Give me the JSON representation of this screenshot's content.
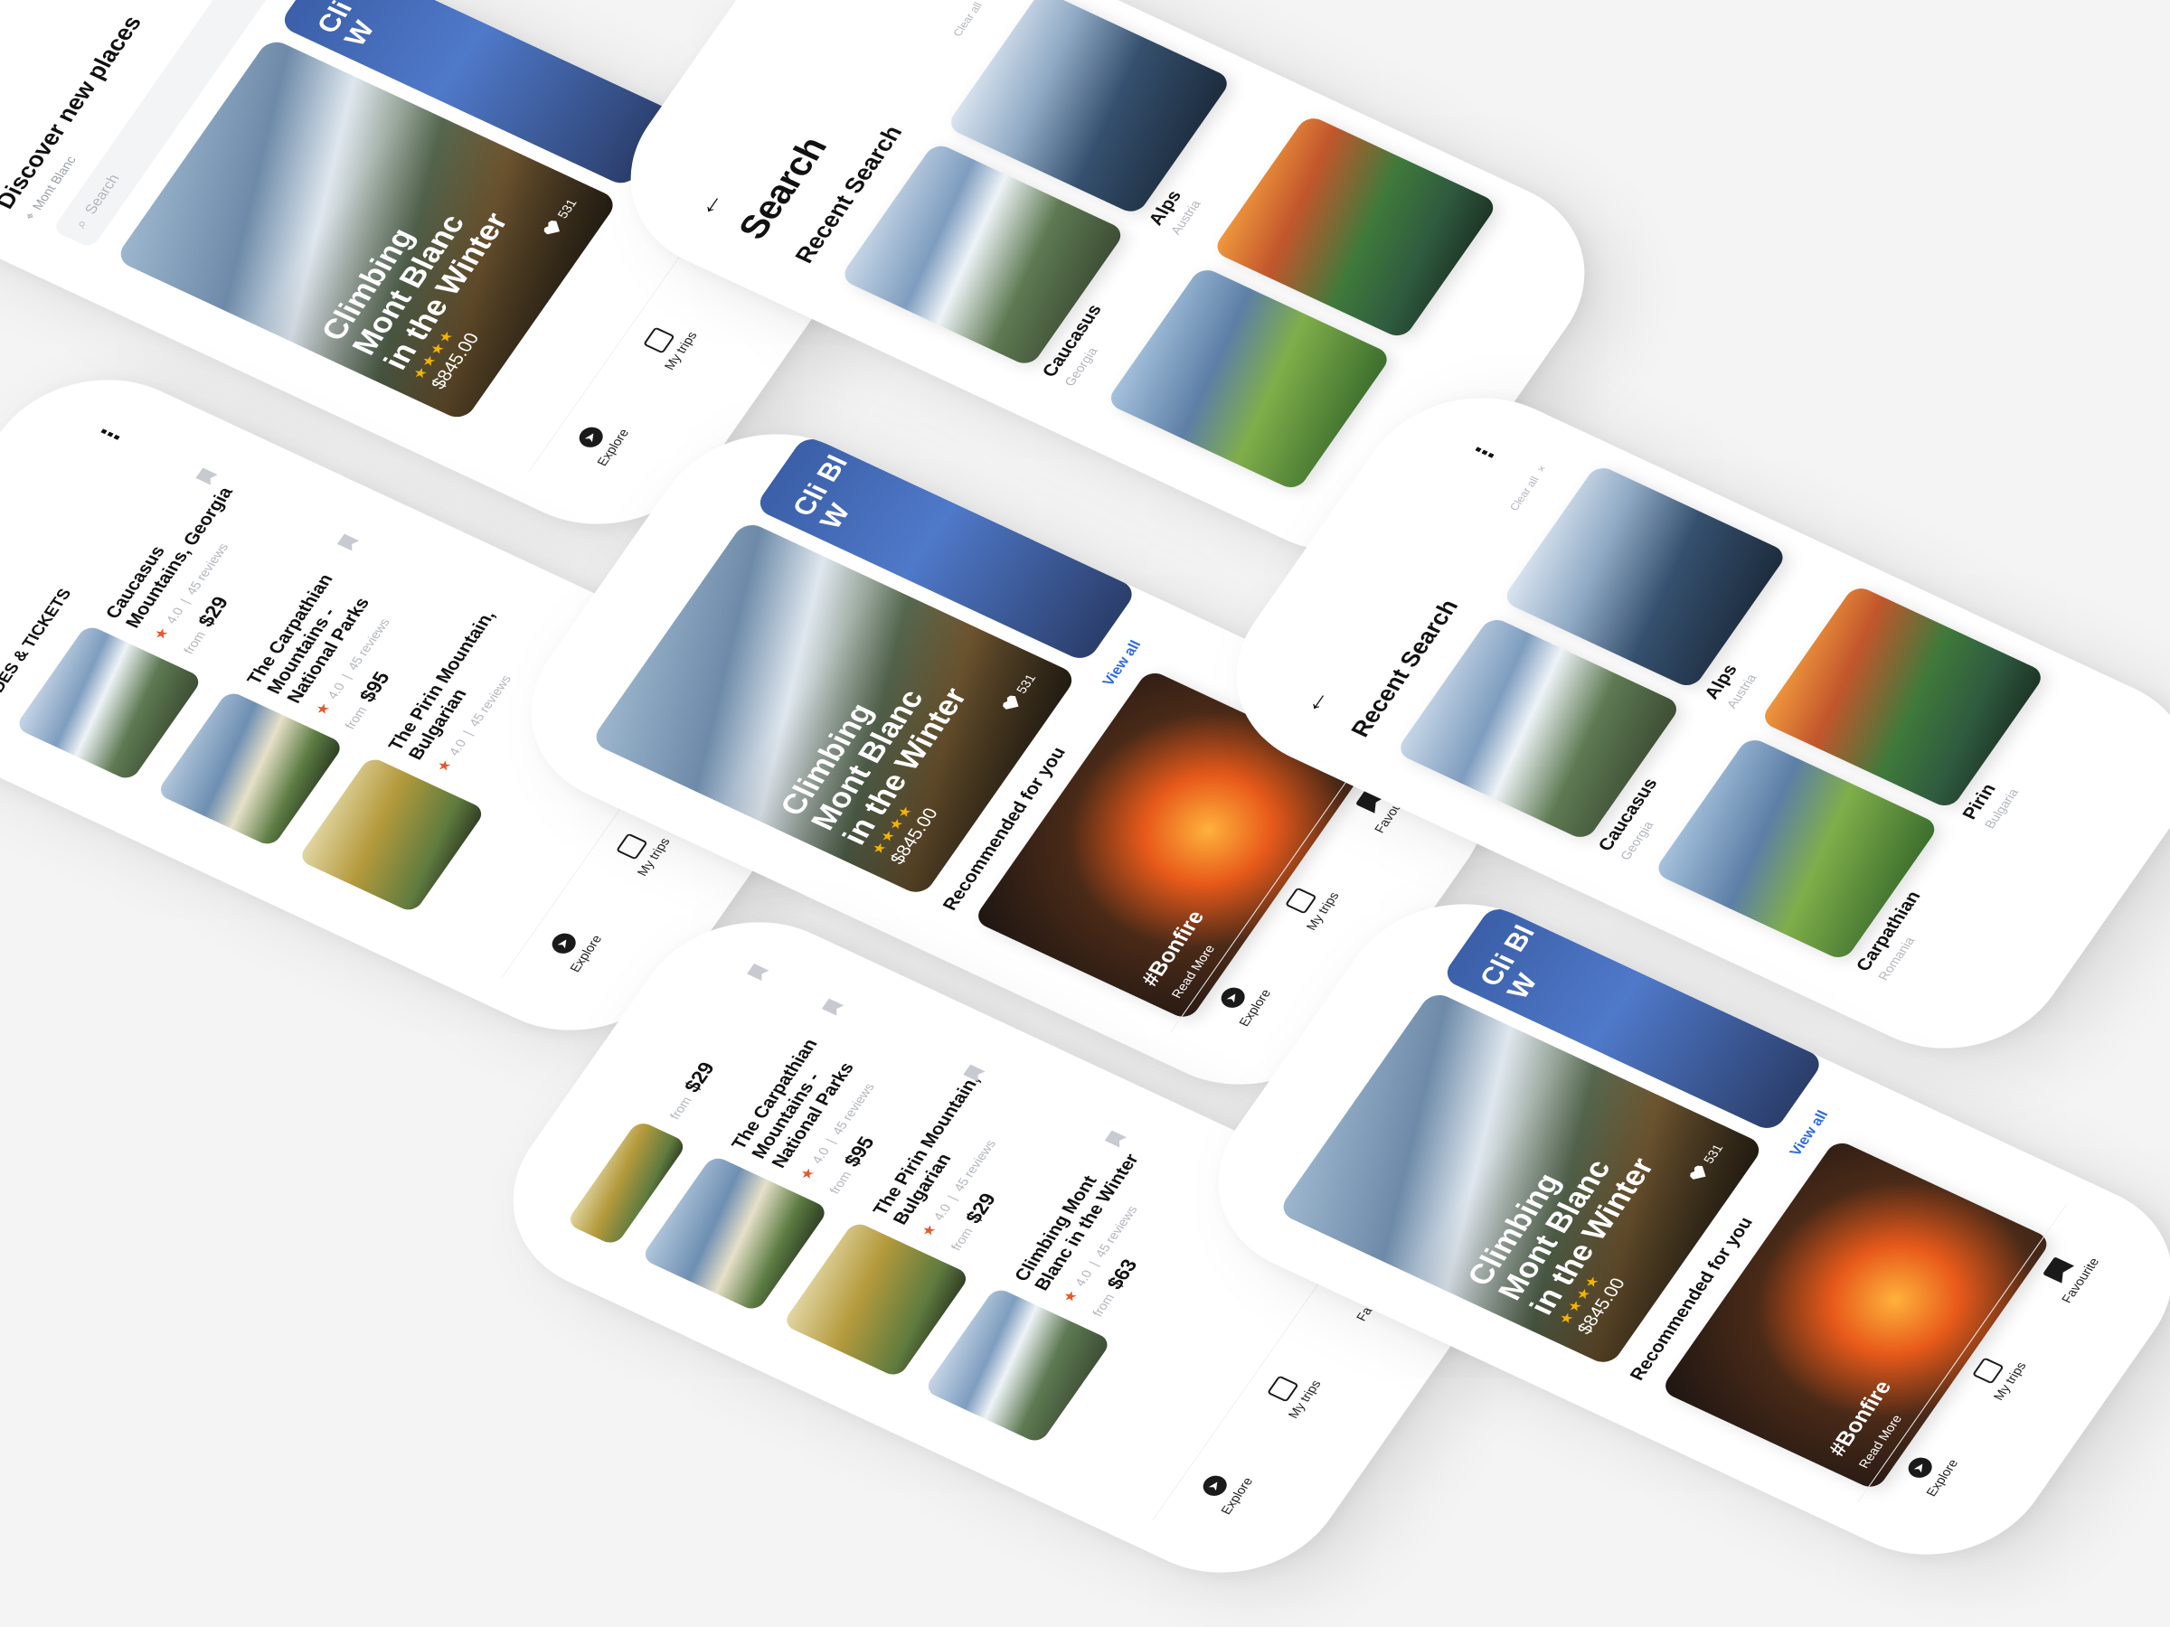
{
  "screens": {
    "discover": {
      "heading": "Discover new places",
      "location": "Mont Blanc",
      "search_placeholder": "Search",
      "hero": {
        "title": "Climbing Mont Blanc in the Winter",
        "price": "$845.00",
        "likes": "531",
        "stars": "★★★★"
      },
      "peek_text": "Cli Bl W"
    },
    "search": {
      "title": "Search",
      "section": "Recent Search",
      "clear": "Clear all",
      "items": [
        {
          "name": "Caucasus",
          "sub": "Georgia"
        },
        {
          "name": "Alps",
          "sub": "Austria"
        },
        {
          "name": "Carpathian",
          "sub": "Romania"
        },
        {
          "name": "Pirin",
          "sub": "Bulgaria"
        }
      ]
    },
    "guides": {
      "title": "GUIDES & TICKETS",
      "items": [
        {
          "title": "Caucasus Mountains, Georgia",
          "rating": "4.0",
          "reviews": "45 reviews",
          "from": "from",
          "price": "$29"
        },
        {
          "title": "The Carpathian Mountains - National Parks",
          "rating": "4.0",
          "reviews": "45 reviews",
          "from": "from",
          "price": "$95"
        },
        {
          "title": "The Pirin Mountain, Bulgarian",
          "rating": "4.0",
          "reviews": "45 reviews",
          "from": "from",
          "price": "$29"
        },
        {
          "title": "Climbing Mont Blanc in the Winter",
          "rating": "4.0",
          "reviews": "45 reviews",
          "from": "from",
          "price": "$63"
        }
      ]
    },
    "recommended": {
      "section": "Recommended for you",
      "view_all": "View all",
      "card_tag": "#Bonfire",
      "card_cta": "Read More"
    }
  },
  "nav": {
    "explore": "Explore",
    "trips": "My trips",
    "favourite": "Favourite"
  },
  "colors": {
    "background": "#f4f4f5",
    "accent_link": "#2f6be0",
    "star": "#e8562b",
    "rating_star": "#f5b400"
  },
  "icons": [
    "search-icon",
    "location-pin-icon",
    "bookmark-icon",
    "heart-icon",
    "back-arrow-icon",
    "more-dots-icon",
    "close-icon",
    "compass-icon",
    "calendar-icon"
  ]
}
